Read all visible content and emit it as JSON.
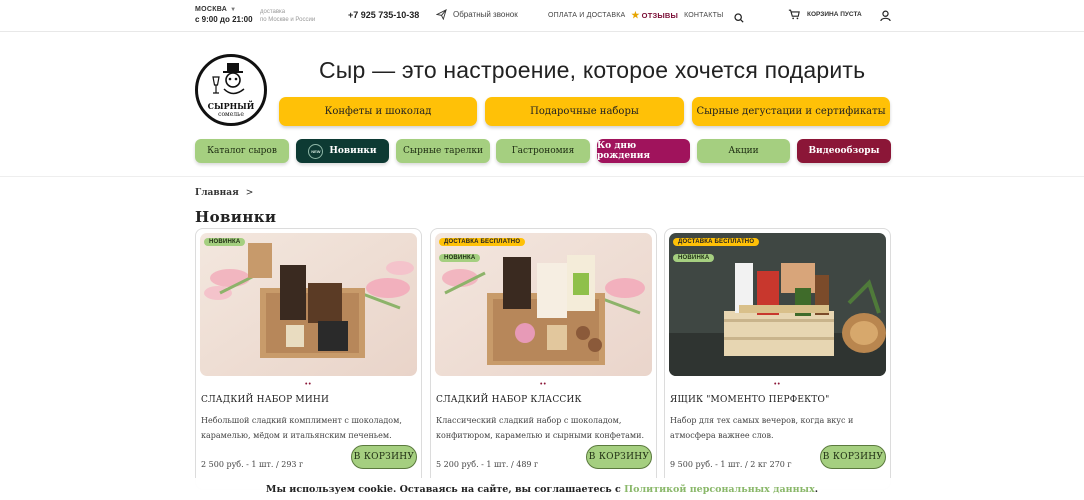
{
  "topbar": {
    "city": "МОСКВА",
    "hours": "с 9:00 до 21:00",
    "delivery_line1": "доставка",
    "delivery_line2": "по Москве и России",
    "phone": "+7 925 735-10-38",
    "callback": "Обратный звонок",
    "nav_payment": "ОПЛАТА И ДОСТАВКА",
    "nav_reviews": "ОТЗЫВЫ",
    "nav_contacts": "КОНТАКТЫ",
    "cart_label": "КОРЗИНА ПУСТА"
  },
  "logo": {
    "word1": "СЫРНЫЙ",
    "word2": "сомелье"
  },
  "headline": "Сыр — это настроение, которое хочется подарить",
  "yellow_buttons": [
    "Конфеты и шоколад",
    "Подарочные наборы",
    "Сырные дегустации и сертификаты"
  ],
  "categories": [
    "Каталог сыров",
    "Новинки",
    "Сырные тарелки",
    "Гастрономия",
    "Ко дню рождения",
    "Акции",
    "Видеообзоры"
  ],
  "new_badge": "NEW",
  "breadcrumb": {
    "home": "Главная",
    "sep": ">"
  },
  "section_title": "Новинки",
  "badges": {
    "new": "НОВИНКА",
    "free_delivery": "ДОСТАВКА БЕСПЛАТНО"
  },
  "buy_label": "В КОРЗИНУ",
  "products": [
    {
      "title": "СЛАДКИЙ НАБОР МИНИ",
      "desc": "Небольшой сладкий комплимент с шоколадом, карамелью, мёдом и итальянским печеньем.",
      "price": "2 500  руб. - 1 шт. / 293 г",
      "dots": "••"
    },
    {
      "title": "СЛАДКИЙ НАБОР КЛАССИК",
      "desc": "Классический сладкий набор с шоколадом, конфитюром, карамелью и сырными конфетами.",
      "price": "5 200  руб. - 1 шт. / 489 г",
      "dots": "••"
    },
    {
      "title": "ЯЩИК \"МОМЕНТО ПЕРФЕКТО\"",
      "desc": "Набор для тех самых вечеров, когда вкус и атмосфера важнее слов.",
      "price": "9 500  руб. - 1 шт. / 2 кг 270 г",
      "dots": "••"
    }
  ],
  "cookie": {
    "text": "Мы используем cookie. Оставаясь на сайте, вы соглашаетесь с ",
    "link": "Политикой персональных данных",
    "end": "."
  },
  "colors": {
    "yellow": "#ffc107",
    "green": "#a5cf80",
    "dark_green": "#0d3a33",
    "magenta": "#a0135c",
    "crimson": "#8b1637"
  }
}
